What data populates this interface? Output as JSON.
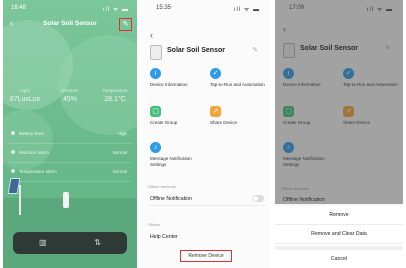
{
  "screen1": {
    "status_time": "16:48",
    "status_icons": "ıll ᯤ ▬",
    "title": "Solar Soil Sensor",
    "stats": [
      {
        "label": "Light",
        "value": "87LuxLux"
      },
      {
        "label": "Moisture",
        "value": "45%"
      },
      {
        "label": "Temperature",
        "value": "28.1°C"
      }
    ],
    "rows": [
      {
        "label": "Battery level",
        "value": "High"
      },
      {
        "label": "Moisture alarm",
        "value": "Normal"
      },
      {
        "label": "Temperature alarm",
        "value": "Normal"
      }
    ]
  },
  "screen2": {
    "status_time": "15:35",
    "status_icons": "ıll ᯤ ▬",
    "device_name": "Solar Soil Sensor",
    "actions": [
      {
        "label": "Device Information",
        "icon": "info-icon",
        "color": "#2f9be8"
      },
      {
        "label": "Tap-to-Run and Automation",
        "icon": "check-icon",
        "color": "#2f9be8"
      },
      {
        "label": "Create Group",
        "icon": "group-icon",
        "color": "#44c07a"
      },
      {
        "label": "Share Device",
        "icon": "share-icon",
        "color": "#f3a53a"
      },
      {
        "label": "Message Notification Settings",
        "icon": "bell-icon",
        "color": "#2f9be8"
      }
    ],
    "section_offline": "Offline reminder",
    "offline_notification": "Offline Notification",
    "section_others": "Others",
    "help_center": "Help Center",
    "remove_device": "Remove Device"
  },
  "screen3": {
    "status_time": "17:09",
    "status_icons": "ıll ᯤ ▬",
    "device_name": "Solar Soil Sensor",
    "actions": [
      {
        "label": "Device Information"
      },
      {
        "label": "Tap-to-Run and Automation"
      },
      {
        "label": "Create Group"
      },
      {
        "label": "Share Device"
      },
      {
        "label": "Message Notification Settings"
      }
    ],
    "section_offline": "Offline reminder",
    "offline_notification": "Offline Notification",
    "sheet": {
      "remove": "Remove",
      "remove_clear": "Remove and Clear Data",
      "cancel": "Cancel"
    }
  }
}
